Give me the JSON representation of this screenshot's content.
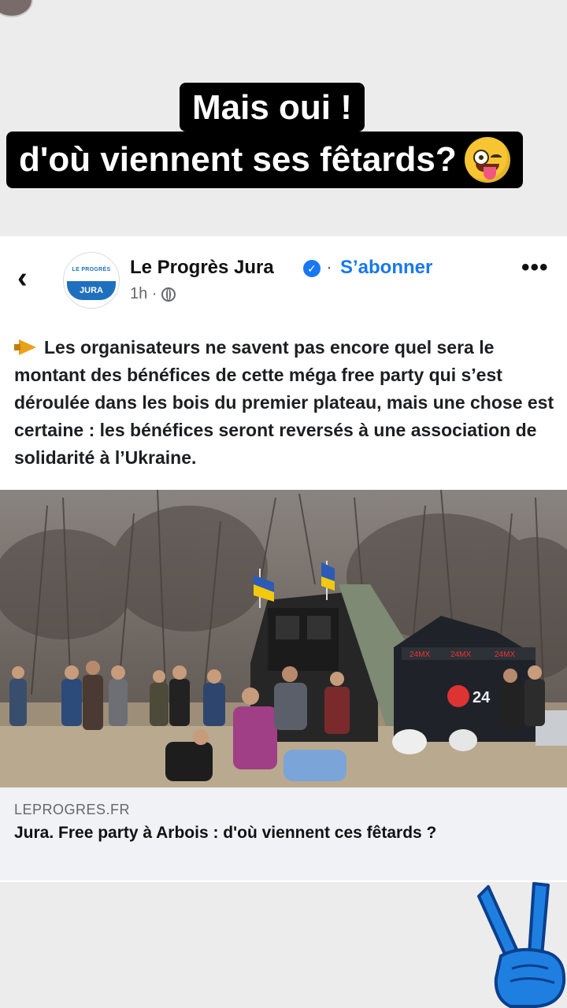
{
  "caption": {
    "line1": "Mais oui !",
    "line2": "d'où viennent ses fêtards?",
    "emoji": "winking-face-with-tongue-icon"
  },
  "post": {
    "page_name": "Le Progrès Jura",
    "verified_icon": "verified-badge-icon",
    "separator": "·",
    "subscribe_label": "S’abonner",
    "time": "1h ·",
    "audience_icon": "globe-icon",
    "logo": {
      "top_text": "LE PROGRÈS",
      "band_text": "JURA"
    },
    "text": "Les organisateurs ne savent pas encore quel sera le montant des bénéfices de cette méga free party qui s’est déroulée dans les bois du premier plateau, mais une chose est certaine : les bénéfices seront reversés à une association de solidarité à l’Ukraine.",
    "photo_tent_labels": [
      "24MX",
      "24MX",
      "24MX",
      "24"
    ],
    "link": {
      "domain": "LEPROGRES.FR",
      "title": "Jura. Free party à Arbois : d'où viennent ces fêtards ?"
    }
  },
  "colors": {
    "accent": "#1877f2",
    "caption_bg": "#000000",
    "link_bar_bg": "#f0f2f5",
    "logo_blue": "#1f6fbf"
  }
}
